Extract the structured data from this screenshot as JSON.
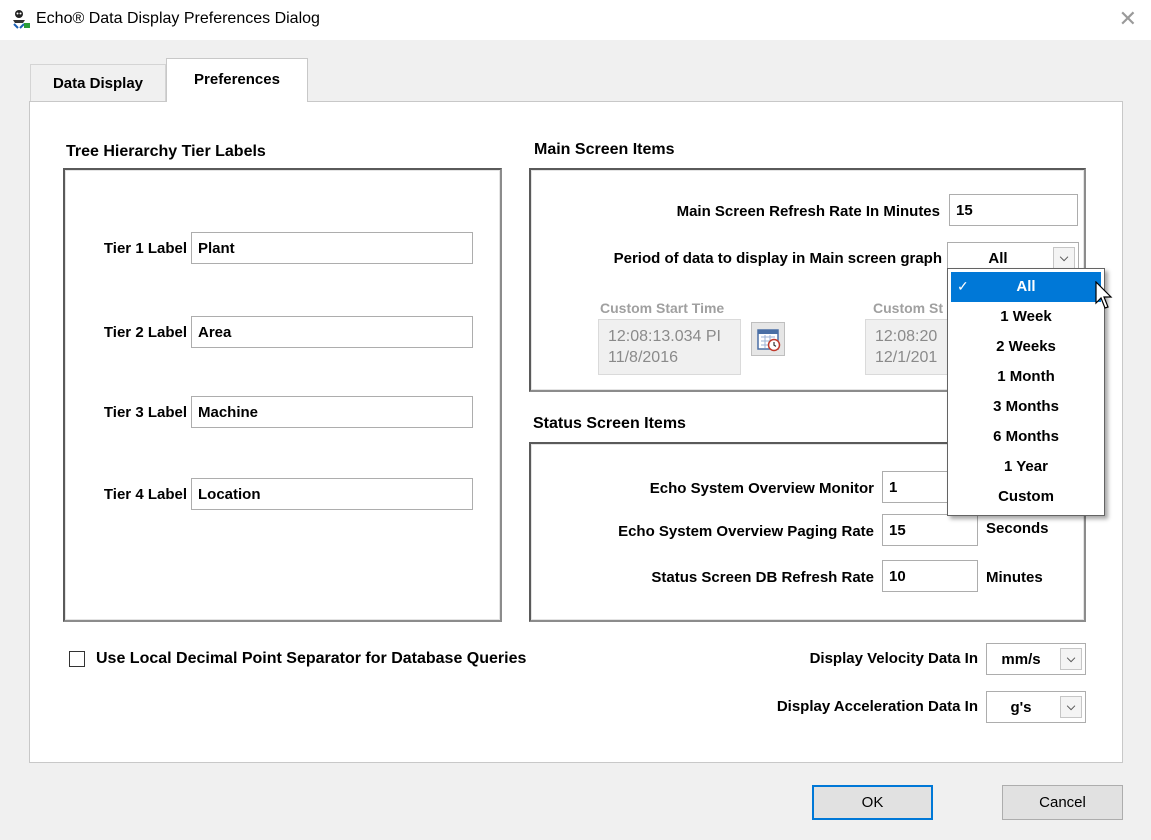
{
  "window": {
    "title": "Echo® Data Display Preferences Dialog",
    "close_glyph": "✕",
    "app_icon": "pirate-figure-icon"
  },
  "tabs": [
    {
      "label": "Data Display",
      "active": false
    },
    {
      "label": "Preferences",
      "active": true
    }
  ],
  "tree_hierarchy": {
    "title": "Tree Hierarchy Tier Labels",
    "tiers": [
      {
        "label": "Tier 1 Label",
        "value": "Plant"
      },
      {
        "label": "Tier 2 Label",
        "value": "Area"
      },
      {
        "label": "Tier 3 Label",
        "value": "Machine"
      },
      {
        "label": "Tier 4 Label",
        "value": "Location"
      }
    ]
  },
  "main_screen": {
    "title": "Main Screen Items",
    "refresh_label": "Main Screen Refresh Rate In Minutes",
    "refresh_value": "15",
    "period_label": "Period of data to display in Main screen graph",
    "period_value": "All",
    "custom_start_label": "Custom Start Time",
    "custom_start_time": "12:08:13.034 PI",
    "custom_start_date": "11/8/2016",
    "custom_stop_label": "Custom St",
    "custom_stop_time": "12:08:20",
    "custom_stop_date": "12/1/201"
  },
  "period_dropdown": {
    "check_glyph": "✓",
    "options": [
      "All",
      "1 Week",
      "2 Weeks",
      "1 Month",
      "3 Months",
      "6 Months",
      "1 Year",
      "Custom"
    ],
    "selected_index": 0
  },
  "status_screen": {
    "title": "Status Screen Items",
    "rows": [
      {
        "label": "Echo System Overview Monitor",
        "value": "1",
        "unit": ""
      },
      {
        "label": "Echo System Overview Paging Rate",
        "value": "15",
        "unit": "Seconds"
      },
      {
        "label": "Status Screen DB Refresh Rate",
        "value": "10",
        "unit": "Minutes"
      }
    ]
  },
  "options": {
    "decimal_separator_label": "Use Local Decimal Point Separator for Database Queries",
    "decimal_separator_checked": false,
    "velocity_label": "Display Velocity Data In",
    "velocity_value": "mm/s",
    "acceleration_label": "Display Acceleration Data In",
    "acceleration_value": "g's"
  },
  "buttons": {
    "ok": "OK",
    "cancel": "Cancel"
  },
  "colors": {
    "selection": "#0078d7",
    "default_button_border": "#0078d7"
  }
}
